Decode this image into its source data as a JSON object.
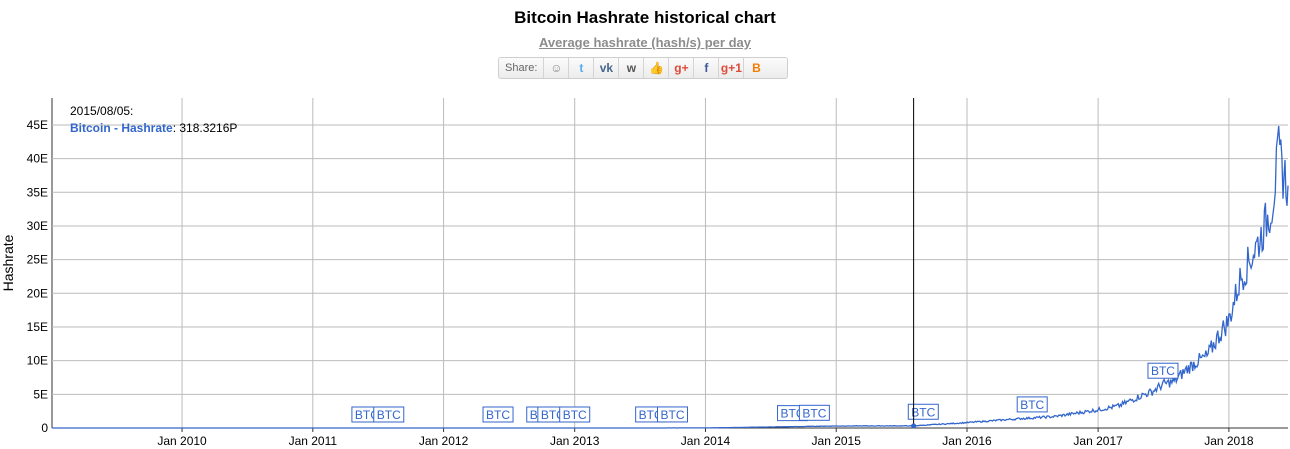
{
  "header": {
    "title": "Bitcoin Hashrate historical chart",
    "subtitle": "Average hashrate (hash/s) per day"
  },
  "share": {
    "label": "Share:",
    "buttons": [
      {
        "icon": "reddit-icon",
        "glyph": "☺",
        "color": "#888888"
      },
      {
        "icon": "twitter-icon",
        "glyph": "t",
        "color": "#55acee"
      },
      {
        "icon": "vk-icon",
        "glyph": "vk",
        "color": "#45668e"
      },
      {
        "icon": "weibo-icon",
        "glyph": "w",
        "color": "#555555"
      },
      {
        "icon": "like-icon",
        "glyph": "👍",
        "color": "#3b5998"
      },
      {
        "icon": "google-plus-icon",
        "glyph": "g+",
        "color": "#dd4b39"
      },
      {
        "icon": "facebook-icon",
        "glyph": "f",
        "color": "#3b5998"
      },
      {
        "icon": "google-plus-one-icon",
        "glyph": "g+1",
        "color": "#dd4b39"
      },
      {
        "icon": "blogger-icon",
        "glyph": "B",
        "color": "#f57d00"
      }
    ]
  },
  "tooltip": {
    "date": "2015/08/05:",
    "series_label": "Bitcoin - Hashrate",
    "value": ": 318.3216P"
  },
  "colors": {
    "series": "#3366cc",
    "grid": "#bbbbbb"
  },
  "chart_data": {
    "type": "line",
    "ylabel": "Hashrate",
    "y_ticks": [
      "0",
      "5E",
      "10E",
      "15E",
      "20E",
      "25E",
      "30E",
      "35E",
      "40E",
      "45E"
    ],
    "ylim": [
      0,
      49
    ],
    "x_ticks": [
      "Jan 2010",
      "Jan 2011",
      "Jan 2012",
      "Jan 2013",
      "Jan 2014",
      "Jan 2015",
      "Jan 2016",
      "Jan 2017",
      "Jan 2018"
    ],
    "xlim": [
      "2009-01-03",
      "2018-06-15"
    ],
    "cursor_date": "2015-08-05",
    "series": [
      {
        "name": "Bitcoin - Hashrate",
        "x": [
          "2009-01-03",
          "2013-01-01",
          "2014-01-01",
          "2015-01-01",
          "2015-08-05",
          "2016-01-01",
          "2016-06-01",
          "2016-09-01",
          "2017-01-01",
          "2017-03-01",
          "2017-05-01",
          "2017-06-01",
          "2017-07-01",
          "2017-08-01",
          "2017-09-01",
          "2017-10-01",
          "2017-11-01",
          "2017-12-01",
          "2018-01-01",
          "2018-02-01",
          "2018-03-01",
          "2018-04-01",
          "2018-05-01",
          "2018-05-20",
          "2018-06-01",
          "2018-06-15"
        ],
        "values": [
          0,
          2e-05,
          0.01,
          0.3,
          0.32,
          0.8,
          1.4,
          1.7,
          2.7,
          3.3,
          4.8,
          5.4,
          6.5,
          6.9,
          8.5,
          9.8,
          10.6,
          13.5,
          16.0,
          22.0,
          25.0,
          28.5,
          33.0,
          40.5,
          38.0,
          36.0
        ]
      }
    ],
    "annotations": [
      {
        "date": "2011-06-01",
        "label": "BTC"
      },
      {
        "date": "2011-08-01",
        "label": "BTC"
      },
      {
        "date": "2012-06-01",
        "label": "BTC"
      },
      {
        "date": "2012-10-01",
        "label": "BTC"
      },
      {
        "date": "2012-11-01",
        "label": "BTC"
      },
      {
        "date": "2013-01-01",
        "label": "BTC"
      },
      {
        "date": "2013-08-01",
        "label": "BTC"
      },
      {
        "date": "2013-10-01",
        "label": "BTC"
      },
      {
        "date": "2014-09-01",
        "label": "BTC"
      },
      {
        "date": "2014-11-01",
        "label": "BTC"
      },
      {
        "date": "2015-09-01",
        "label": "BTC"
      },
      {
        "date": "2016-07-01",
        "label": "BTC"
      },
      {
        "date": "2017-07-01",
        "label": "BTC"
      }
    ]
  }
}
